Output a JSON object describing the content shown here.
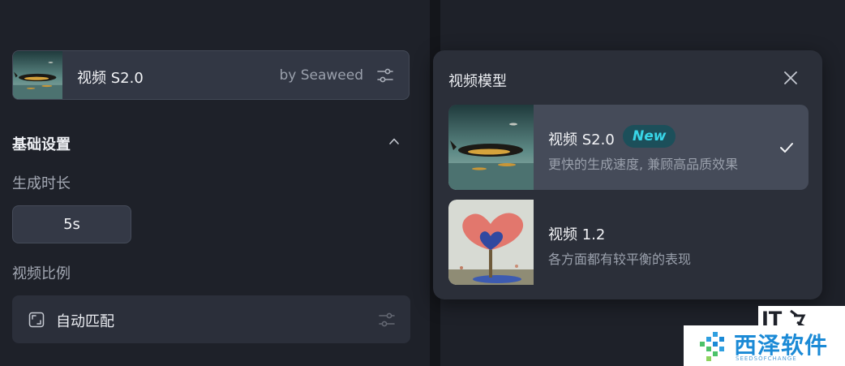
{
  "model_selector": {
    "name": "视频 S2.0",
    "by": "by Seaweed"
  },
  "settings": {
    "section_title": "基础设置",
    "duration_label": "生成时长",
    "duration_value": "5s",
    "ratio_label": "视频比例",
    "ratio_value": "自动匹配"
  },
  "popover": {
    "title": "视频模型",
    "options": [
      {
        "name": "视频 S2.0",
        "badge": "New",
        "description": "更快的生成速度, 兼顾高品质效果",
        "selected": true,
        "icon": "whale-thumbnail"
      },
      {
        "name": "视频 1.2",
        "description": "各方面都有较平衡的表现",
        "selected": false,
        "icon": "flower-thumbnail"
      }
    ]
  },
  "watermarks": {
    "it_home": "IT之家",
    "brand": "西泽软件",
    "brand_sub": "SEEDSOFCHANGE"
  },
  "colors": {
    "accent_cyan": "#38d6e8",
    "background": "#1e2129",
    "selected_row": "#454b59"
  }
}
